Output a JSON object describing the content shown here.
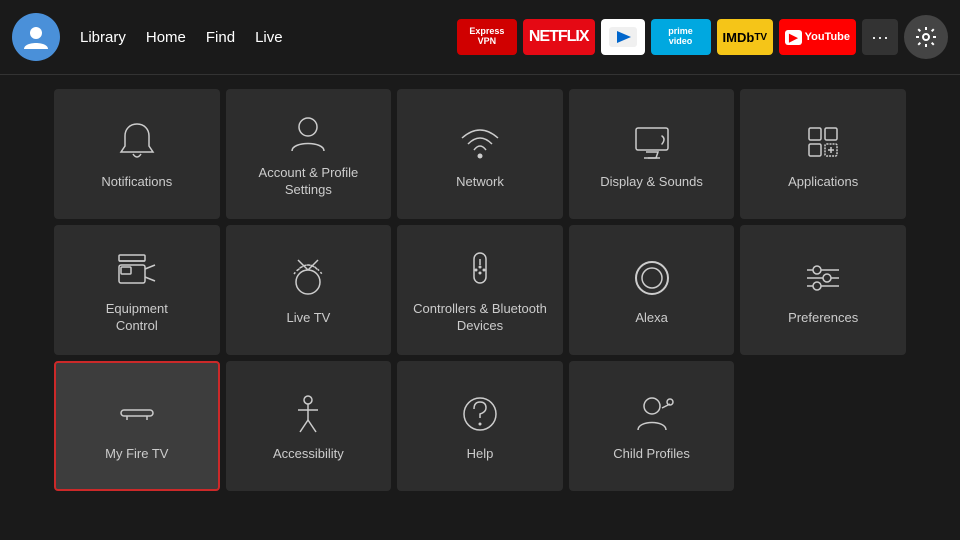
{
  "nav": {
    "links": [
      "Library",
      "Home",
      "Find",
      "Live"
    ],
    "apps": [
      {
        "name": "ExpressVPN",
        "label": "ExpressVPN",
        "class": "btn-express"
      },
      {
        "name": "Netflix",
        "label": "NETFLIX",
        "class": "btn-netflix"
      },
      {
        "name": "FreePlay",
        "label": "▶",
        "class": "btn-freeplay"
      },
      {
        "name": "PrimeVideo",
        "label": "prime video",
        "class": "btn-prime"
      },
      {
        "name": "IMDbTV",
        "label": "IMDb TV",
        "class": "btn-imdb"
      },
      {
        "name": "YouTube",
        "label": "▶ YouTube",
        "class": "btn-youtube"
      }
    ]
  },
  "grid": {
    "items": [
      {
        "id": "notifications",
        "label": "Notifications",
        "icon": "bell"
      },
      {
        "id": "account-profile",
        "label": "Account & Profile Settings",
        "icon": "user-circle"
      },
      {
        "id": "network",
        "label": "Network",
        "icon": "wifi"
      },
      {
        "id": "display-sounds",
        "label": "Display & Sounds",
        "icon": "monitor-sound"
      },
      {
        "id": "applications",
        "label": "Applications",
        "icon": "apps"
      },
      {
        "id": "equipment-control",
        "label": "Equipment Control",
        "icon": "tv-monitor"
      },
      {
        "id": "live-tv",
        "label": "Live TV",
        "icon": "antenna"
      },
      {
        "id": "controllers-bluetooth",
        "label": "Controllers & Bluetooth Devices",
        "icon": "remote"
      },
      {
        "id": "alexa",
        "label": "Alexa",
        "icon": "alexa"
      },
      {
        "id": "preferences",
        "label": "Preferences",
        "icon": "sliders"
      },
      {
        "id": "my-fire-tv",
        "label": "My Fire TV",
        "icon": "fire-tv",
        "selected": true
      },
      {
        "id": "accessibility",
        "label": "Accessibility",
        "icon": "accessibility"
      },
      {
        "id": "help",
        "label": "Help",
        "icon": "help-circle"
      },
      {
        "id": "child-profiles",
        "label": "Child Profiles",
        "icon": "child-profile"
      }
    ]
  }
}
